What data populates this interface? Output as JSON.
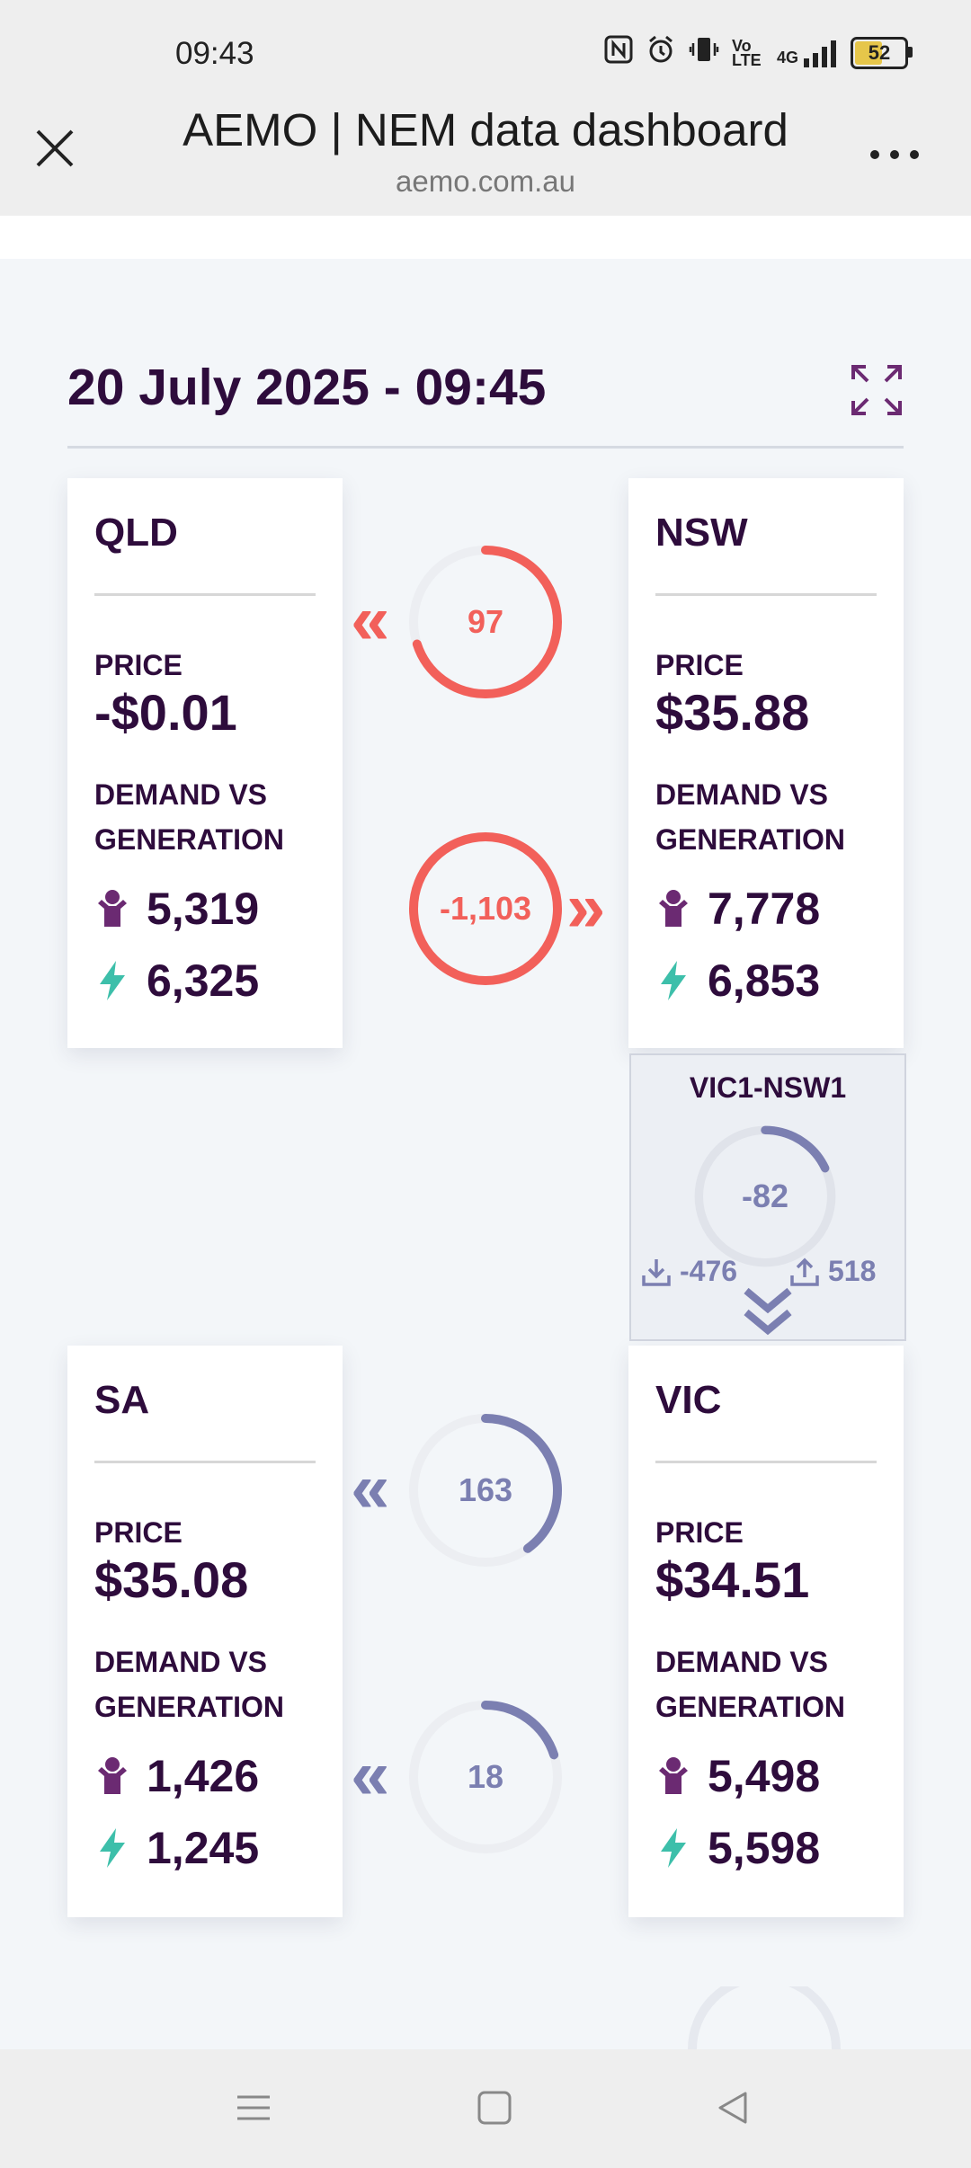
{
  "status_bar": {
    "time": "09:43",
    "network": "4G",
    "volte": "Vo LTE",
    "battery": "52"
  },
  "browser": {
    "title": "AEMO | NEM data dashboard",
    "url": "aemo.com.au"
  },
  "dashboard": {
    "datetime": "20 July 2025 - 09:45",
    "price_label": "PRICE",
    "dvg_label": "DEMAND VS GENERATION",
    "regions": {
      "qld": {
        "name": "QLD",
        "price": "-$0.01",
        "demand": "5,319",
        "generation": "6,325"
      },
      "nsw": {
        "name": "NSW",
        "price": "$35.88",
        "demand": "7,778",
        "generation": "6,853"
      },
      "sa": {
        "name": "SA",
        "price": "$35.08",
        "demand": "1,426",
        "generation": "1,245"
      },
      "vic": {
        "name": "VIC",
        "price": "$34.51",
        "demand": "5,498",
        "generation": "5,598"
      }
    },
    "flows": {
      "qld_nsw_top": {
        "value": "97",
        "direction": "left",
        "color": "#f2605a",
        "level": 0.7
      },
      "qld_nsw_bottom": {
        "value": "-1,103",
        "direction": "right",
        "color": "#f2605a",
        "level": 1.0
      },
      "sa_vic_top": {
        "value": "163",
        "direction": "left",
        "color": "#7b7fb1",
        "level": 0.4
      },
      "sa_vic_bottom": {
        "value": "18",
        "direction": "left",
        "color": "#7b7fb1",
        "level": 0.2
      }
    },
    "interconnector": {
      "name": "VIC1-NSW1",
      "value": "-82",
      "import": "-476",
      "export": "518",
      "color": "#7b7fb1",
      "level": 0.18
    }
  },
  "colors": {
    "accent": "#2e0c3c",
    "demand_icon": "#6b2a72",
    "generation_icon": "#3dbfaa",
    "flow_red": "#f2605a",
    "flow_purple": "#7b7fb1"
  },
  "icons": [
    "close-icon",
    "more-icon",
    "expand-icon",
    "demand-icon",
    "generation-icon",
    "import-icon",
    "export-icon",
    "menu-icon",
    "home-icon",
    "back-icon"
  ]
}
